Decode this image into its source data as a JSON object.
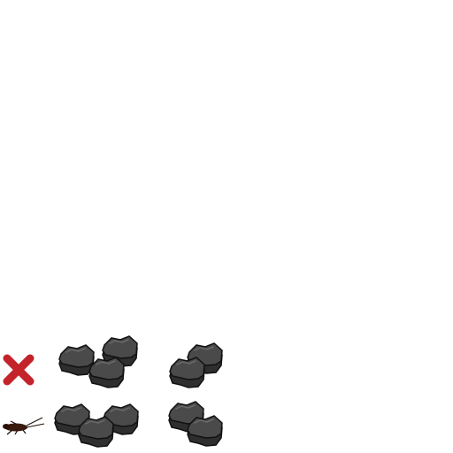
{
  "colors": {
    "background": "#ffffff",
    "cross": "#c4232b",
    "rock_top": "#4a4a4a",
    "rock_side": "#2e2e2e",
    "rock_outline": "#111111",
    "rock_highlight": "#6a6a6a",
    "insect_body": "#3a1a0e",
    "insect_leg": "#1a0d08"
  },
  "icons": {
    "cross": "wrong-cross-icon",
    "insect": "cockroach-icon",
    "tile": "rock-tile-icon"
  },
  "rows": [
    {
      "row": "top",
      "marker": "wrong-cross-icon",
      "groups": [
        {
          "group": "left",
          "count": 3
        },
        {
          "group": "right",
          "count": 2
        }
      ]
    },
    {
      "row": "bottom",
      "marker": "cockroach-icon",
      "groups": [
        {
          "group": "left",
          "count": 3
        },
        {
          "group": "right",
          "count": 2
        }
      ]
    }
  ]
}
